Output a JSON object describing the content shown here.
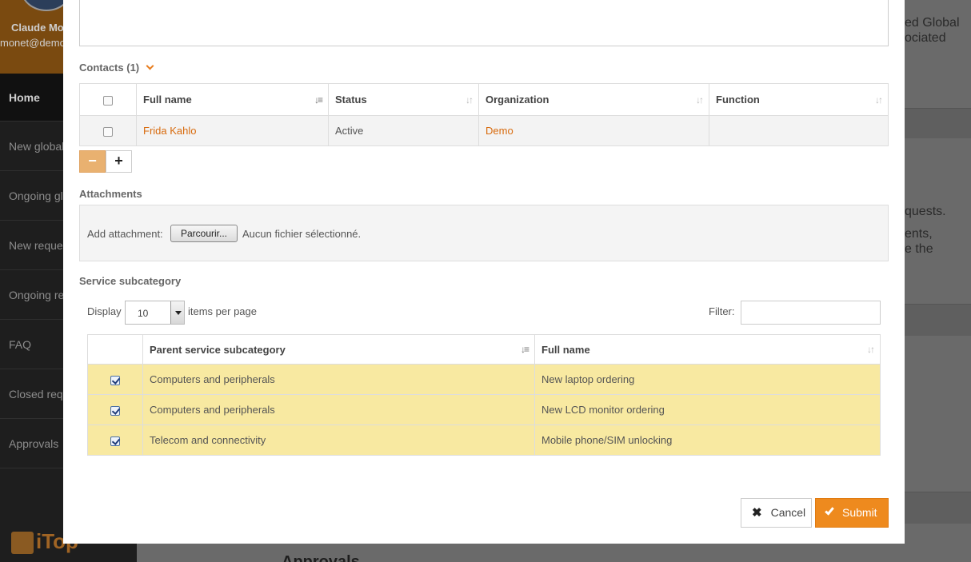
{
  "background": {
    "user_name": "Claude Mo",
    "user_email": "monet@demo",
    "nav": [
      "Home",
      "New global",
      "Ongoing gl",
      "New reque",
      "Ongoing re",
      "FAQ",
      "Closed requ",
      "Approvals"
    ],
    "logo_text": "iTop",
    "side_text_1": "ed Global",
    "side_text_2": "ociated",
    "side_text_3": "quests.",
    "side_text_4": "ents,",
    "side_text_5": "e the",
    "approvals_heading": "Approvals"
  },
  "contacts": {
    "title": "Contacts",
    "count": "(1)",
    "columns": [
      "Full name",
      "Status",
      "Organization",
      "Function"
    ],
    "rows": [
      {
        "full_name": "Frida Kahlo",
        "status": "Active",
        "organization": "Demo",
        "function": ""
      }
    ],
    "remove_label": "−",
    "add_label": "+"
  },
  "attachments": {
    "title": "Attachments",
    "add_label": "Add attachment:",
    "browse_label": "Parcourir...",
    "no_file_label": "Aucun fichier sélectionné."
  },
  "service_subcategory": {
    "title": "Service subcategory",
    "display_label": "Display",
    "page_size": "10",
    "items_per_page_label": "items per page",
    "filter_label": "Filter:",
    "filter_value": "",
    "columns": [
      "Parent service subcategory",
      "Full name"
    ],
    "rows": [
      {
        "checked": true,
        "parent": "Computers and peripherals",
        "full_name": "New laptop ordering"
      },
      {
        "checked": true,
        "parent": "Computers and peripherals",
        "full_name": "New LCD monitor ordering"
      },
      {
        "checked": true,
        "parent": "Telecom and connectivity",
        "full_name": "Mobile phone/SIM unlocking"
      }
    ]
  },
  "actions": {
    "cancel_label": "Cancel",
    "submit_label": "Submit"
  },
  "colors": {
    "accent": "#ee8a1e",
    "link": "#d86b0e",
    "selected_row": "#f8e9a1"
  }
}
